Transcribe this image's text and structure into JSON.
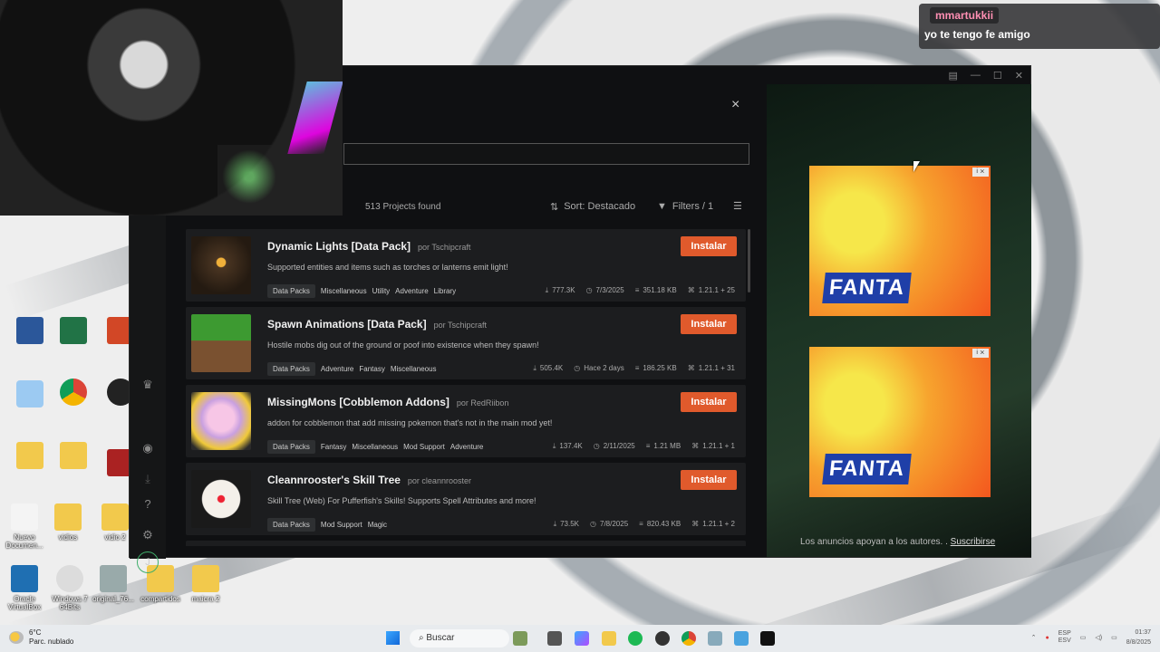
{
  "chat": {
    "username": "mmartukkii",
    "message": "yo te tengo fe amigo"
  },
  "window": {
    "controls": [
      "▤",
      "—",
      "☐",
      "✕"
    ]
  },
  "modal": {
    "close_label": "×",
    "search_value": ""
  },
  "list_bar": {
    "projects_found": "513 Projects found",
    "sort_label": "Sort: Destacado",
    "filters_label": "Filters / 1"
  },
  "projects": [
    {
      "title": "Dynamic Lights [Data Pack]",
      "author": "por Tschipcraft",
      "description": "Supported entities and items such as torches or lanterns emit light!",
      "tags": [
        "Data Packs",
        "Miscellaneous",
        "Utility",
        "Adventure",
        "Library"
      ],
      "downloads": "777.3K",
      "updated": "7/3/2025",
      "size": "351.18 KB",
      "versions": "1.21.1 + 25",
      "install_label": "Instalar",
      "thumb_color": "#3a2d1e"
    },
    {
      "title": "Spawn Animations [Data Pack]",
      "author": "por Tschipcraft",
      "description": "Hostile mobs dig out of the ground or poof into existence when they spawn!",
      "tags": [
        "Data Packs",
        "Adventure",
        "Fantasy",
        "Miscellaneous"
      ],
      "downloads": "505.4K",
      "updated": "Hace 2 days",
      "size": "186.25 KB",
      "versions": "1.21.1 + 31",
      "install_label": "Instalar",
      "thumb_color": "#3c8a2e"
    },
    {
      "title": "MissingMons [Cobblemon Addons]",
      "author": "por RedRiibon",
      "description": "addon for cobblemon that add missing pokemon that's not in the main mod yet!",
      "tags": [
        "Data Packs",
        "Fantasy",
        "Miscellaneous",
        "Mod Support",
        "Adventure"
      ],
      "downloads": "137.4K",
      "updated": "2/11/2025",
      "size": "1.21 MB",
      "versions": "1.21.1 + 1",
      "install_label": "Instalar",
      "thumb_color": "#e9a7d6"
    },
    {
      "title": "Cleannrooster's Skill Tree",
      "author": "por cleannrooster",
      "description": "Skill Tree (Web) For Pufferfish's Skills! Supports Spell Attributes and more!",
      "tags": [
        "Data Packs",
        "Mod Support",
        "Magic"
      ],
      "downloads": "73.5K",
      "updated": "7/8/2025",
      "size": "820.43 KB",
      "versions": "1.21.1 + 2",
      "install_label": "Instalar",
      "thumb_color": "#d9d2c8"
    }
  ],
  "ads": {
    "brand": "FANTA",
    "footer_text": "Los anuncios apoyan a los autores. .",
    "footer_link": "Suscribirse"
  },
  "rail": {
    "avatar_initial": "J"
  },
  "desktop_icons": [
    {
      "label": "Nuevo Documen...",
      "color": "#f4f4f4"
    },
    {
      "label": "vidios",
      "color": "#f2c94c"
    },
    {
      "label": "vidio 2",
      "color": "#f2c94c"
    },
    {
      "label": "Oracle VirtualBox",
      "color": "#1f6fb2"
    },
    {
      "label": "Windows 7 64Bits",
      "color": "#dcdcdc"
    },
    {
      "label": "original_76...",
      "color": "#9aa"
    },
    {
      "label": "compartidos",
      "color": "#f2c94c"
    },
    {
      "label": "maicra 2",
      "color": "#f2c94c"
    }
  ],
  "taskbar": {
    "weather_temp": "6°C",
    "weather_desc": "Parc. nublado",
    "search_label": "Buscar",
    "lang_top": "ESP",
    "lang_bottom": "ESV",
    "time": "01:37",
    "date": "8/8/2025"
  }
}
